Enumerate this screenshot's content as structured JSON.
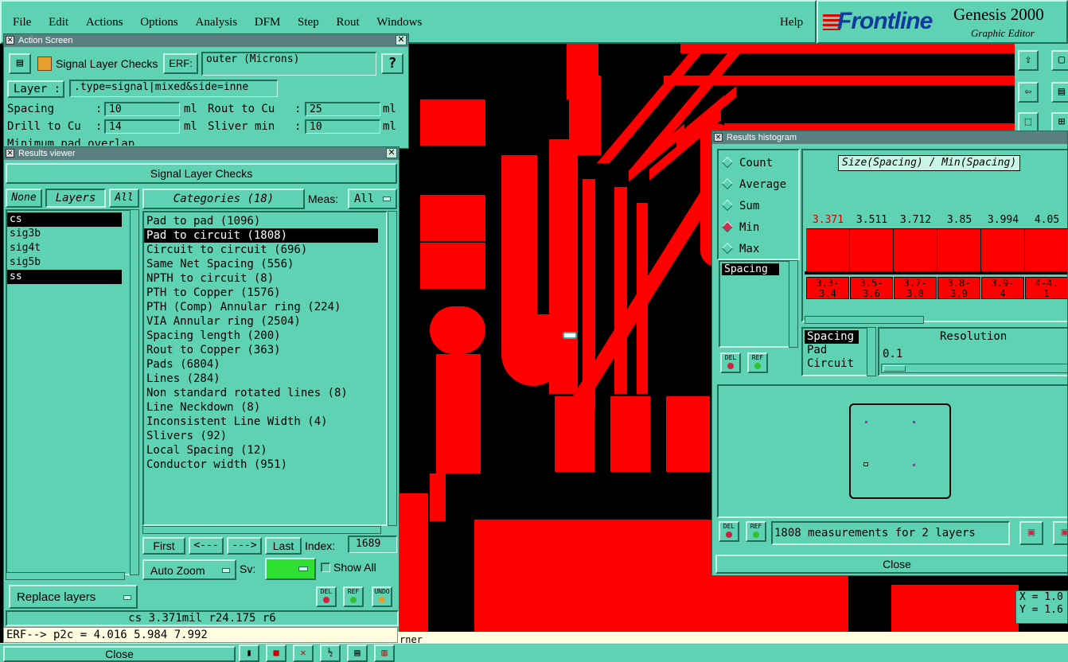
{
  "menubar": {
    "items": [
      "File",
      "Edit",
      "Actions",
      "Options",
      "Analysis",
      "DFM",
      "Step",
      "Rout",
      "Windows"
    ],
    "help": "Help"
  },
  "brand": {
    "logo": "Frontline",
    "product": "Genesis 2000",
    "subtitle": "Graphic Editor"
  },
  "action_screen": {
    "title": "Action Screen",
    "checklist_name": "Signal Layer Checks",
    "erf_label": "ERF:",
    "erf_value": "outer (Microns)",
    "help_label": "?",
    "layer_label": "Layer :",
    "layer_value": ".type=signal|mixed&side=inne",
    "params": [
      {
        "label": "Spacing",
        "value": "10",
        "unit": "ml"
      },
      {
        "label": "Rout to Cu",
        "value": "25",
        "unit": "ml"
      },
      {
        "label": "Drill to Cu",
        "value": "14",
        "unit": "ml"
      },
      {
        "label": "Sliver min",
        "value": "10",
        "unit": "ml"
      }
    ],
    "partial_row": "Minimum pad overlap"
  },
  "results_viewer": {
    "title": "Results viewer",
    "header": "Signal Layer Checks",
    "none_label": "None",
    "layers_label": "Layers",
    "all_label": "All",
    "layers": [
      {
        "name": "cs",
        "selected": true
      },
      {
        "name": "sig3b",
        "selected": false
      },
      {
        "name": "sig4t",
        "selected": false
      },
      {
        "name": "sig5b",
        "selected": false
      },
      {
        "name": "ss",
        "selected": true
      }
    ],
    "categories_label": "Categories (18)",
    "meas_label": "Meas:",
    "meas_value": "All",
    "categories": [
      {
        "label": "Pad to pad (1096)",
        "selected": false
      },
      {
        "label": "Pad to circuit (1808)",
        "selected": true
      },
      {
        "label": "Circuit to circuit (696)",
        "selected": false
      },
      {
        "label": "Same Net Spacing (556)",
        "selected": false
      },
      {
        "label": "NPTH to circuit (8)",
        "selected": false
      },
      {
        "label": "PTH to Copper (1576)",
        "selected": false
      },
      {
        "label": "PTH (Comp) Annular ring (224)",
        "selected": false
      },
      {
        "label": "VIA Annular ring (2504)",
        "selected": false
      },
      {
        "label": "Spacing length (200)",
        "selected": false
      },
      {
        "label": "Rout to Copper (363)",
        "selected": false
      },
      {
        "label": "Pads (6804)",
        "selected": false
      },
      {
        "label": "Lines (284)",
        "selected": false
      },
      {
        "label": "Non standard rotated lines (8)",
        "selected": false
      },
      {
        "label": "Line Neckdown (8)",
        "selected": false
      },
      {
        "label": "Inconsistent Line Width (4)",
        "selected": false
      },
      {
        "label": "Slivers (92)",
        "selected": false
      },
      {
        "label": "Local Spacing (12)",
        "selected": false
      },
      {
        "label": "Conductor width (951)",
        "selected": false
      }
    ],
    "nav": {
      "first": "First",
      "prev": "<---",
      "next": "--->",
      "last": "Last",
      "index_label": "Index:",
      "index_value": "1689"
    },
    "auto_zoom": "Auto Zoom",
    "sv_label": "Sv:",
    "show_all": "Show All",
    "replace_layers": "Replace layers",
    "del": "DEL",
    "ref": "REF",
    "undo": "UNDO",
    "status": "cs 3.371mil  r24.175  r6"
  },
  "erf_line": "ERF--> p2c = 4.016 5.984 7.992",
  "close_label": "Close",
  "bottom_hint": "rner",
  "coords": {
    "x": "X = 1.0",
    "y": "Y = 1.6"
  },
  "histogram": {
    "title": "Results histogram",
    "modes": [
      {
        "label": "Count",
        "on": false
      },
      {
        "label": "Average",
        "on": false
      },
      {
        "label": "Sum",
        "on": false
      },
      {
        "label": "Min",
        "on": true
      },
      {
        "label": "Max",
        "on": false
      }
    ],
    "chart_title": "Size(Spacing) / Min(Spacing)",
    "bins": [
      {
        "value": "3.371",
        "range": "3.3-3.4",
        "highlight": true
      },
      {
        "value": "3.511",
        "range": "3.5-3.6",
        "highlight": false
      },
      {
        "value": "3.712",
        "range": "3.7-3.8",
        "highlight": false
      },
      {
        "value": "3.85",
        "range": "3.8-3.9",
        "highlight": false
      },
      {
        "value": "3.994",
        "range": "3.9-4",
        "highlight": false
      },
      {
        "value": "4.05",
        "range": "4-4.1",
        "highlight": false
      }
    ],
    "left_list": [
      "Spacing"
    ],
    "attr_list": [
      "Spacing",
      "Pad",
      "Circuit"
    ],
    "resolution_label": "Resolution",
    "resolution_value": "0.1",
    "measurements": "1808 measurements for 2 layers",
    "del": "DEL",
    "ref": "REF",
    "close": "Close"
  }
}
